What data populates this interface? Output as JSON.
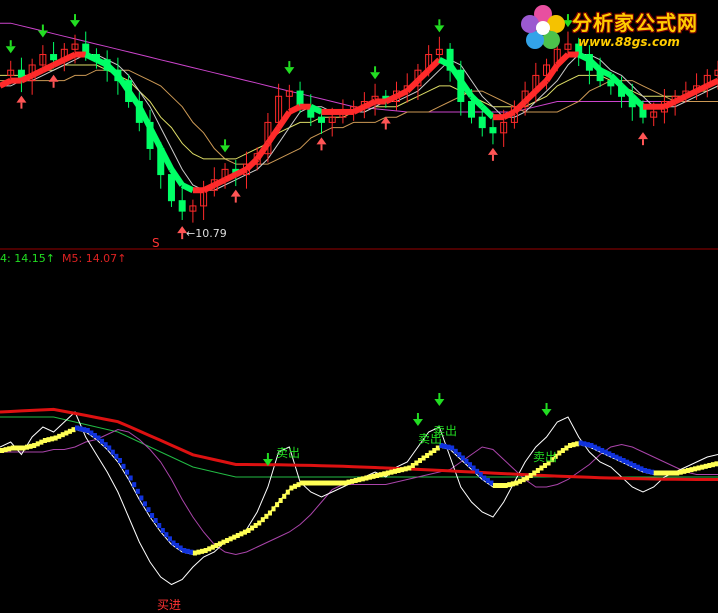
{
  "watermark": {
    "site_name": "分析家公式网",
    "url": "www.88gs.com",
    "icon": "flower-logo-icon",
    "text_color": "#ffcc00",
    "outline_color": "#7a0000"
  },
  "colors": {
    "background": "#000000",
    "separator": "#990000",
    "bull": "#ff2a2a",
    "bear": "#00ff66",
    "up_arrow": "#ff5555",
    "down_arrow": "#22dd22",
    "price_line": "#ffffff",
    "ma_purple": "#cc44cc",
    "ma_orange": "#cc9955",
    "ma_yellow": "#dddd66",
    "ma_white": "#cccccc",
    "long_line": "#dd1111",
    "green_line": "#22bb44",
    "purple_line": "#aa44aa",
    "yellow_step": "#ffff55",
    "blue_step": "#1133dd"
  },
  "top_panel": {
    "low_marker": "S",
    "low_value_label": "←10.79",
    "legend": [
      {
        "text": "4: 14.15",
        "arrow": "↑",
        "color": "#22dd22"
      },
      {
        "text": "M5: 14.07",
        "arrow": "↑",
        "color": "#dd2222"
      }
    ]
  },
  "bottom_panel": {
    "sell_label": "卖出",
    "buy_label": "买进",
    "sell_signals": [
      {
        "label": "卖出",
        "color": "#22dd22"
      },
      {
        "label": "卖出",
        "color": "#22dd22"
      },
      {
        "label": "卖出",
        "color": "#22dd22"
      },
      {
        "label": "卖出",
        "color": "#22dd22"
      }
    ],
    "buy_signal": {
      "label": "买进",
      "color": "#ff3333"
    }
  },
  "chart_data": {
    "type": "line",
    "price": [
      13.5,
      13.6,
      13.4,
      13.7,
      13.9,
      13.8,
      14.0,
      14.1,
      13.9,
      13.8,
      13.6,
      13.4,
      13.0,
      12.6,
      12.1,
      11.6,
      11.1,
      10.9,
      11.0,
      11.3,
      11.5,
      11.7,
      11.6,
      11.8,
      12.0,
      12.6,
      13.1,
      13.2,
      12.9,
      12.7,
      12.6,
      12.7,
      12.8,
      12.9,
      13.0,
      13.1,
      13.0,
      13.2,
      13.3,
      13.6,
      13.9,
      14.0,
      13.6,
      13.0,
      12.7,
      12.5,
      12.4,
      12.6,
      12.9,
      13.2,
      13.5,
      13.7,
      14.0,
      14.1,
      13.9,
      13.6,
      13.4,
      13.3,
      13.1,
      12.9,
      12.7,
      12.8,
      13.0,
      13.1,
      13.2,
      13.3,
      13.5,
      13.6
    ],
    "ma_short": [
      13.3,
      13.4,
      13.4,
      13.5,
      13.6,
      13.7,
      13.8,
      13.9,
      13.9,
      13.8,
      13.7,
      13.5,
      13.2,
      12.9,
      12.5,
      12.1,
      11.7,
      11.4,
      11.3,
      11.3,
      11.4,
      11.5,
      11.6,
      11.7,
      11.9,
      12.2,
      12.5,
      12.8,
      12.9,
      12.9,
      12.8,
      12.8,
      12.8,
      12.8,
      12.9,
      13.0,
      13.0,
      13.1,
      13.2,
      13.4,
      13.6,
      13.8,
      13.7,
      13.4,
      13.1,
      12.9,
      12.7,
      12.7,
      12.8,
      13.0,
      13.2,
      13.4,
      13.7,
      13.9,
      13.9,
      13.8,
      13.6,
      13.5,
      13.3,
      13.1,
      12.9,
      12.9,
      12.9,
      13.0,
      13.1,
      13.2,
      13.3,
      13.4
    ],
    "ma_mid": [
      13.5,
      13.5,
      13.5,
      13.5,
      13.6,
      13.6,
      13.7,
      13.7,
      13.7,
      13.7,
      13.6,
      13.5,
      13.4,
      13.2,
      13.0,
      12.7,
      12.5,
      12.2,
      12.0,
      11.9,
      11.9,
      11.9,
      11.9,
      12.0,
      12.1,
      12.2,
      12.4,
      12.5,
      12.6,
      12.6,
      12.7,
      12.7,
      12.7,
      12.8,
      12.8,
      12.9,
      12.9,
      12.9,
      13.0,
      13.1,
      13.2,
      13.3,
      13.3,
      13.2,
      13.1,
      13.0,
      12.9,
      12.9,
      12.9,
      12.9,
      13.0,
      13.1,
      13.3,
      13.4,
      13.5,
      13.5,
      13.5,
      13.4,
      13.3,
      13.2,
      13.1,
      13.1,
      13.1,
      13.1,
      13.1,
      13.2,
      13.2,
      13.3
    ],
    "ma_long": [
      14.5,
      14.5,
      14.45,
      14.4,
      14.35,
      14.3,
      14.25,
      14.2,
      14.15,
      14.1,
      14.05,
      14.0,
      13.95,
      13.9,
      13.85,
      13.8,
      13.75,
      13.7,
      13.65,
      13.6,
      13.55,
      13.5,
      13.45,
      13.4,
      13.35,
      13.3,
      13.25,
      13.2,
      13.15,
      13.1,
      13.05,
      13.0,
      12.95,
      12.9,
      12.88,
      12.86,
      12.84,
      12.82,
      12.8,
      12.8,
      12.8,
      12.8,
      12.8,
      12.8,
      12.8,
      12.8,
      12.8,
      12.8,
      12.8,
      12.85,
      12.9,
      12.95,
      13.0,
      13.0,
      13.0,
      13.0,
      13.0,
      13.0,
      13.0,
      13.0,
      13.0,
      13.0,
      13.0,
      13.0,
      13.0,
      13.0,
      13.0,
      13.0
    ],
    "osc_price": [
      58,
      60,
      55,
      62,
      66,
      64,
      68,
      72,
      62,
      55,
      48,
      40,
      30,
      20,
      12,
      6,
      3,
      5,
      10,
      14,
      16,
      20,
      22,
      25,
      32,
      42,
      56,
      58,
      44,
      40,
      38,
      40,
      42,
      44,
      46,
      48,
      46,
      50,
      52,
      58,
      64,
      66,
      54,
      42,
      36,
      32,
      30,
      36,
      44,
      52,
      58,
      62,
      68,
      70,
      62,
      56,
      52,
      50,
      46,
      42,
      40,
      42,
      46,
      48,
      50,
      52,
      54,
      55
    ],
    "osc_mid": [
      56,
      57,
      57,
      58,
      60,
      61,
      63,
      65,
      64,
      61,
      57,
      52,
      45,
      37,
      30,
      24,
      19,
      16,
      15,
      16,
      18,
      20,
      22,
      24,
      27,
      31,
      36,
      41,
      43,
      43,
      43,
      43,
      43,
      44,
      45,
      46,
      47,
      48,
      49,
      52,
      55,
      58,
      57,
      53,
      49,
      45,
      42,
      42,
      43,
      45,
      48,
      51,
      55,
      58,
      59,
      58,
      56,
      54,
      52,
      50,
      48,
      47,
      47,
      47,
      48,
      49,
      50,
      51
    ],
    "osc_long": [
      70,
      70,
      70,
      70,
      70,
      70,
      69,
      68,
      67,
      66,
      65,
      64,
      62,
      60,
      58,
      56,
      54,
      52,
      50,
      49,
      48,
      47,
      46,
      46,
      46,
      46,
      46,
      46,
      46,
      46,
      46,
      46,
      46,
      46,
      46,
      46,
      46,
      46,
      46,
      46,
      46,
      46,
      46,
      46,
      46,
      46,
      46,
      46,
      46,
      46,
      46,
      46,
      46,
      46,
      46,
      46,
      46,
      46,
      46,
      46,
      46,
      46,
      46,
      46,
      46,
      46,
      46,
      46
    ],
    "ylim_top": [
      10.5,
      14.6
    ],
    "ylim_bottom": [
      0,
      80
    ]
  }
}
